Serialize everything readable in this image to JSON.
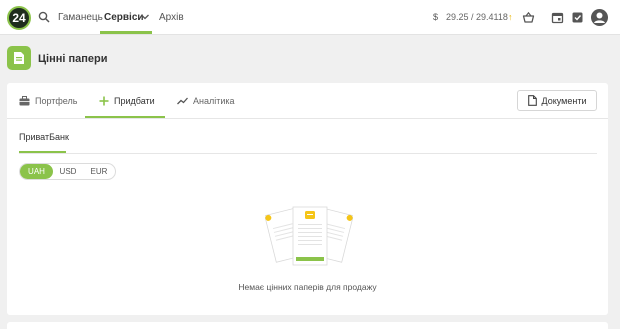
{
  "topbar": {
    "logo_text": "24",
    "nav": [
      {
        "label": "Гаманець"
      },
      {
        "label": "Сервіси"
      },
      {
        "label": "Архів"
      }
    ],
    "currency_symbol": "$",
    "rate": "29.25 / 29.4118",
    "rate_trend": "↑"
  },
  "page": {
    "title": "Цінні папери"
  },
  "tabs": [
    {
      "label": "Портфель",
      "icon": "briefcase-icon"
    },
    {
      "label": "Придбати",
      "icon": "plus-icon"
    },
    {
      "label": "Аналітика",
      "icon": "trend-icon"
    }
  ],
  "documents_button": "Документи",
  "subtab": "ПриватБанк",
  "currencies": [
    "UAH",
    "USD",
    "EUR"
  ],
  "selected_currency": "UAH",
  "empty_message": "Немає цінних паперів для продажу",
  "colors": {
    "accent": "#8bc34a",
    "warning": "#e8b400"
  }
}
